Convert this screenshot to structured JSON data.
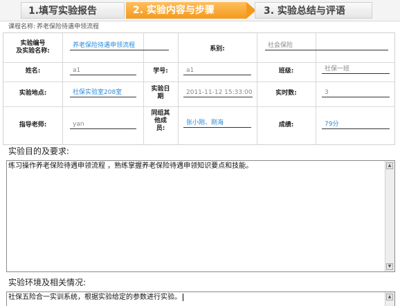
{
  "steps": [
    {
      "label": "1.填写实验报告"
    },
    {
      "label": "2. 实验内容与步骤"
    },
    {
      "label": "3. 实验总结与评语"
    }
  ],
  "course": {
    "label": "课程名称:",
    "value": "养老保险待遇申领流程"
  },
  "form": {
    "exp_no_label": "实验编号\n及实验名称:",
    "exp_no_value": "养老保险待遇申领流程",
    "dept_label": "系别:",
    "dept_value": "社会保险",
    "name_label": "姓名:",
    "name_value": "a1",
    "student_no_label": "学号:",
    "student_no_value": "a1",
    "class_label": "班级:",
    "class_value": "社保一班",
    "location_label": "实验地点:",
    "location_value": "社保实验室208室",
    "date_label": "实验日\n期",
    "date_value": "2011-11-12 15:33:00",
    "hours_label": "实时数:",
    "hours_value": "3",
    "teacher_label": "指导老师:",
    "teacher_value": "yan",
    "group_label": "同组其\n他成\n员:",
    "group_value": "张小刚、刚海",
    "score_label": "成绩:",
    "score_value": "79分"
  },
  "purpose": {
    "title": "实验目的及要求:",
    "text": "练习操作养老保险待遇申领流程 ，熟练掌握养老保险待遇申领知识要点和技能。"
  },
  "environment": {
    "title": "实验环境及相关情况:",
    "text": "社保五险合一实训系统，根据实验给定的参数进行实验。"
  },
  "icons": {
    "scroll_up": "triangle-up",
    "scroll_down": "triangle-down"
  }
}
